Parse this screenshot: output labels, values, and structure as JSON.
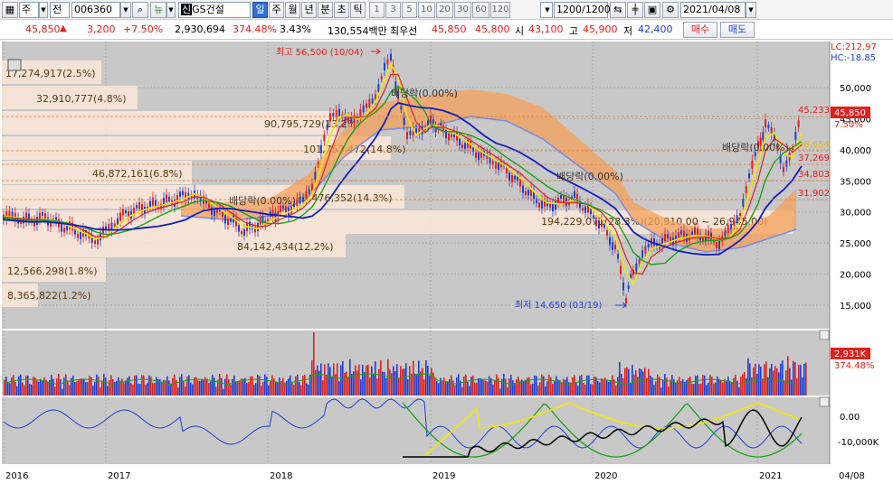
{
  "toolbar": {
    "mode_label": "주",
    "prev_label": "전",
    "code": "006360",
    "filter_label": "뉴",
    "stock_name_prefix": "신",
    "stock_name": "GS건설",
    "periods": [
      "일",
      "주",
      "월",
      "년",
      "분",
      "초",
      "틱"
    ],
    "intervals": [
      "1",
      "3",
      "5",
      "10",
      "20",
      "30",
      "60",
      "120"
    ],
    "count_value": "1200/1200",
    "date_value": "2021/04/08"
  },
  "quote": {
    "price": "45,850",
    "change_arrow": "▲",
    "change": "3,200",
    "change_pct": "+7.50%",
    "volume": "2,930,694",
    "vol_ratio": "374.48%",
    "turnover_pct": "3.43%",
    "amount": "130,554백만",
    "priority_label": "최우선",
    "bid1": "45,850",
    "bid2": "45,800",
    "open_label": "시",
    "open": "43,100",
    "high_label": "고",
    "high": "45,900",
    "low_label": "저",
    "low": "42,400",
    "buy_label": "매수",
    "sell_label": "매도"
  },
  "chart": {
    "lc_label": "LC:212.97",
    "hc_label": "HC:-18.85",
    "high_marker": "최고 56,500 (10/04)",
    "low_marker": "최저 14,650 (03/19)",
    "price_box": "45,850",
    "price_box_pct": "7.50%",
    "ma_values": [
      "45,233",
      "38,654",
      "37,269",
      "34,803",
      "31,902"
    ],
    "dividend_labels": [
      "배당락(0.00%)",
      "배당락(0.00%)",
      "배당락(0.00%)",
      "배당락(0.00%)"
    ],
    "volume_profile": [
      "17,274,917(2.5%)",
      "32,910,777(4.8%)",
      "90,795,729(13.2%)",
      "101,757,472(14.8%)",
      "46,872,161(6.8%)",
      "98,476,352(14.3%)",
      "194,229,071(28.3%)(20,910.00 ~ 26,945.00)",
      "84,142,434(12.2%)",
      "12,566,298(1.8%)",
      "8,365,822(1.2%)"
    ],
    "y_ticks": [
      "50,000",
      "45,000",
      "40,000",
      "35,000",
      "30,000",
      "25,000",
      "20,000",
      "15,000"
    ],
    "vol_box": "2,931K",
    "vol_pct": "374.48%",
    "ind_ticks": [
      "0.00",
      "-10,000K"
    ],
    "x_ticks": [
      "2016",
      "2017",
      "2018",
      "2019",
      "2020",
      "2021",
      "04/08"
    ]
  }
}
